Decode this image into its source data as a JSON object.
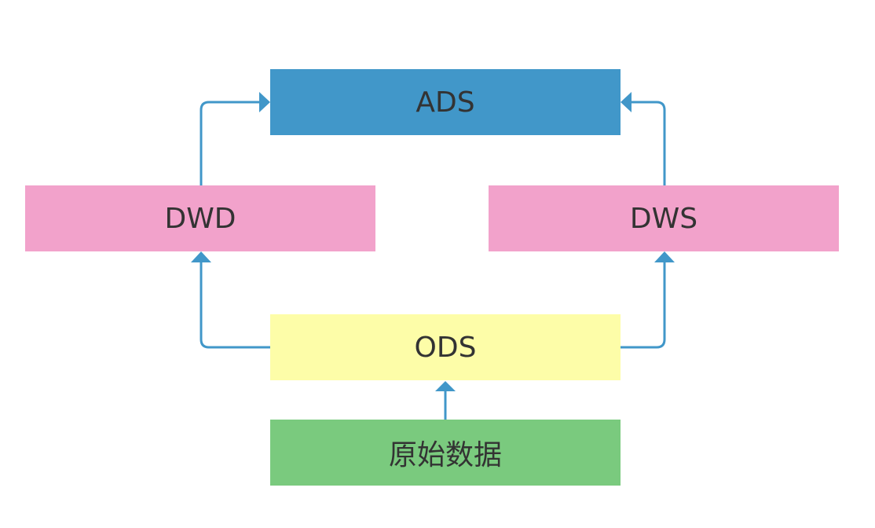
{
  "nodes": {
    "ads": {
      "label": "ADS",
      "color": "#4197C9"
    },
    "dwd": {
      "label": "DWD",
      "color": "#F2A2CB"
    },
    "dws": {
      "label": "DWS",
      "color": "#F2A2CB"
    },
    "ods": {
      "label": "ODS",
      "color": "#FDFDA8"
    },
    "raw": {
      "label": "原始数据",
      "color": "#7ACA7E"
    }
  },
  "edges": [
    {
      "from": "raw",
      "to": "ods"
    },
    {
      "from": "ods",
      "to": "dwd"
    },
    {
      "from": "ods",
      "to": "dws"
    },
    {
      "from": "dwd",
      "to": "ads"
    },
    {
      "from": "dws",
      "to": "ads"
    }
  ],
  "connector_color": "#4197C9"
}
